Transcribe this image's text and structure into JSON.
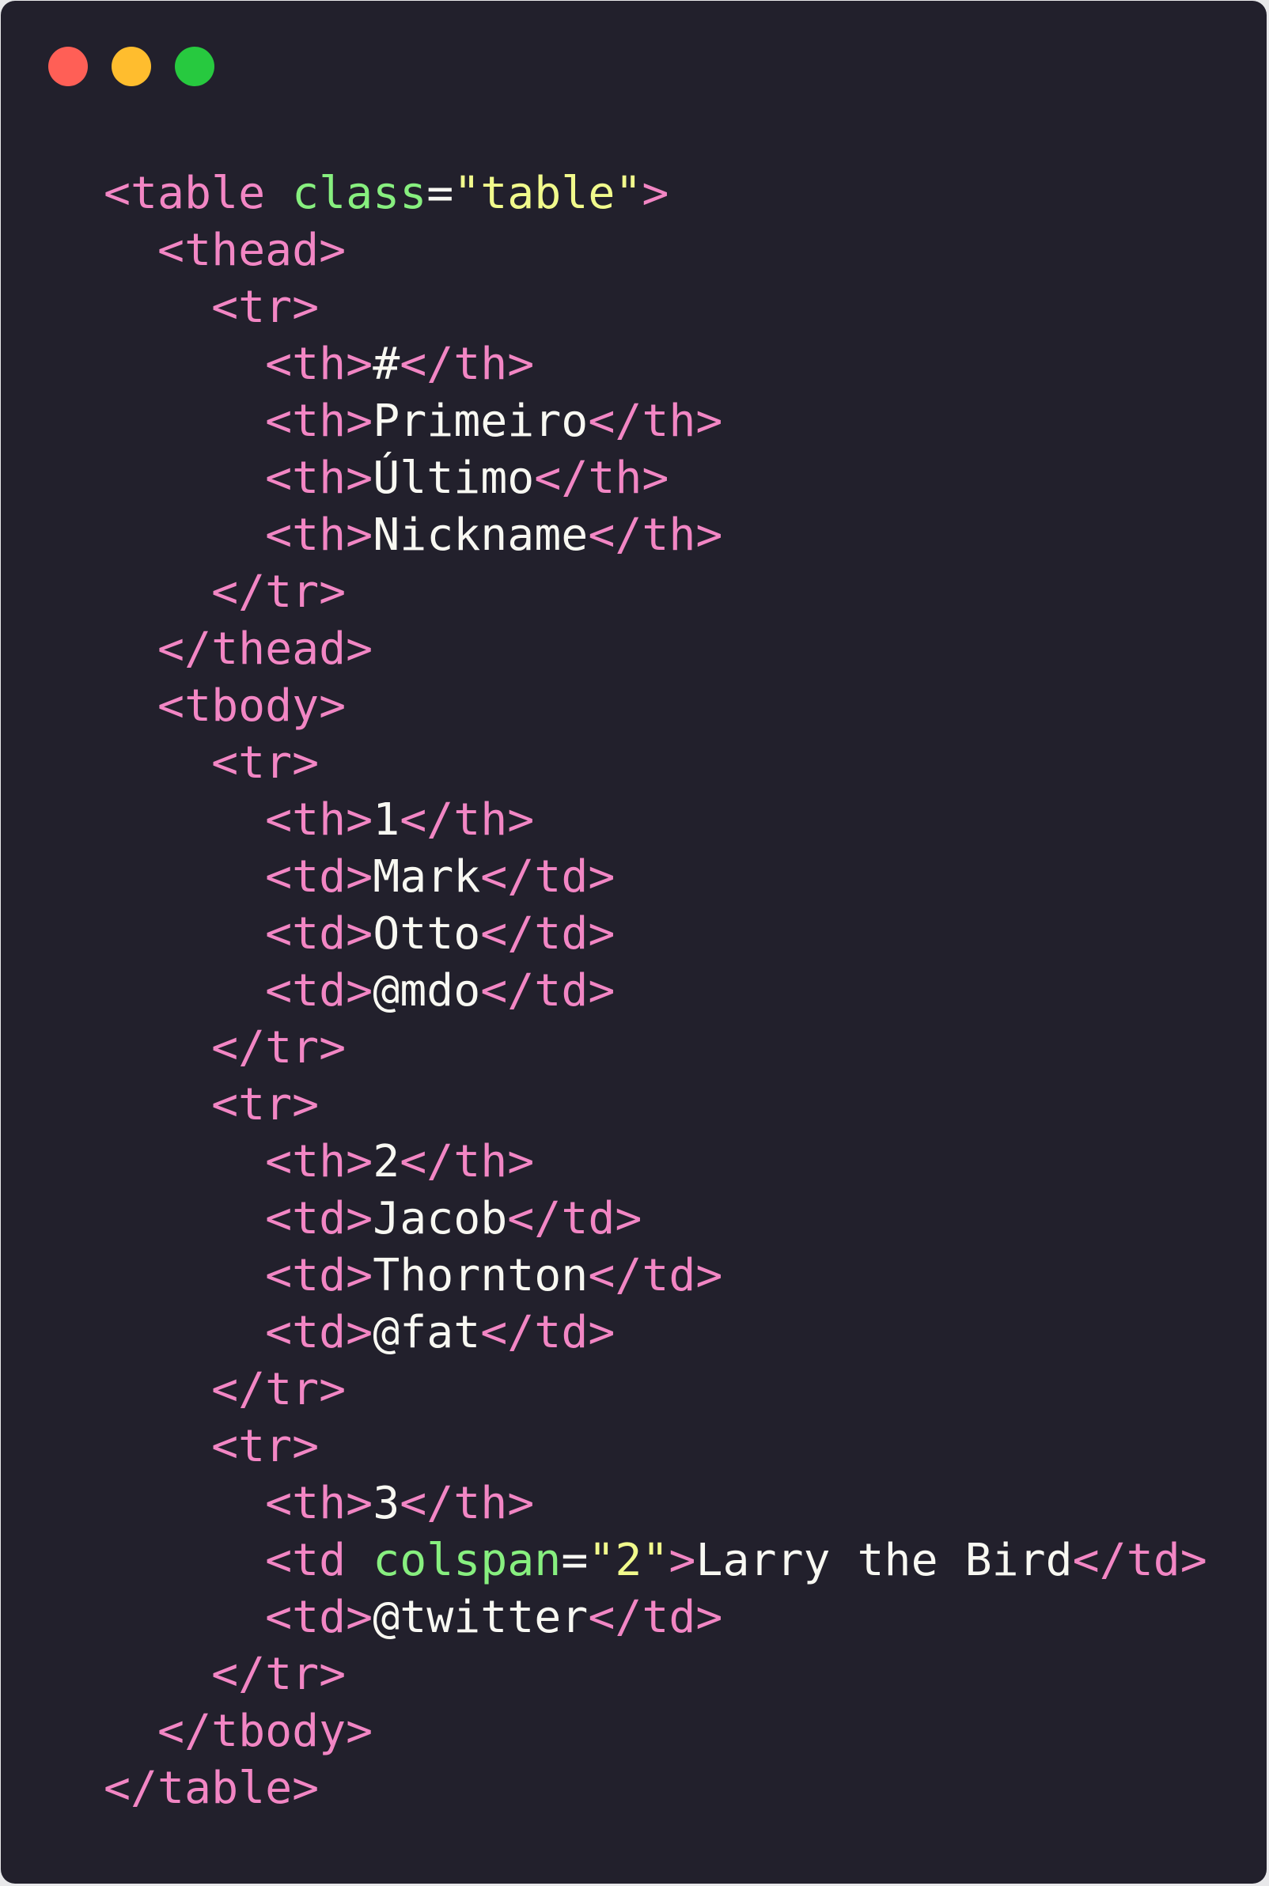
{
  "colors": {
    "background": "#22202c",
    "page_background": "#e8e8ea",
    "window_close": "#ff5f56",
    "window_minimize": "#ffbd2e",
    "window_maximize": "#27c93f",
    "tag": "#f286c4",
    "attribute": "#87ef7f",
    "string": "#f1fa8c",
    "text": "#f8f8f2"
  },
  "window_controls": [
    {
      "name": "close-icon",
      "color": "#ff5f56"
    },
    {
      "name": "minimize-icon",
      "color": "#ffbd2e"
    },
    {
      "name": "maximize-icon",
      "color": "#27c93f"
    }
  ],
  "code": {
    "language": "html",
    "lines": [
      [
        [
          "tag",
          "<table "
        ],
        [
          "attr",
          "class"
        ],
        [
          "text",
          "="
        ],
        [
          "str",
          "\"table\""
        ],
        [
          "tag",
          ">"
        ]
      ],
      [
        [
          "text",
          "  "
        ],
        [
          "tag",
          "<thead>"
        ]
      ],
      [
        [
          "text",
          "    "
        ],
        [
          "tag",
          "<tr>"
        ]
      ],
      [
        [
          "text",
          "      "
        ],
        [
          "tag",
          "<th>"
        ],
        [
          "text",
          "#"
        ],
        [
          "tag",
          "</th>"
        ]
      ],
      [
        [
          "text",
          "      "
        ],
        [
          "tag",
          "<th>"
        ],
        [
          "text",
          "Primeiro"
        ],
        [
          "tag",
          "</th>"
        ]
      ],
      [
        [
          "text",
          "      "
        ],
        [
          "tag",
          "<th>"
        ],
        [
          "text",
          "Último"
        ],
        [
          "tag",
          "</th>"
        ]
      ],
      [
        [
          "text",
          "      "
        ],
        [
          "tag",
          "<th>"
        ],
        [
          "text",
          "Nickname"
        ],
        [
          "tag",
          "</th>"
        ]
      ],
      [
        [
          "text",
          "    "
        ],
        [
          "tag",
          "</tr>"
        ]
      ],
      [
        [
          "text",
          "  "
        ],
        [
          "tag",
          "</thead>"
        ]
      ],
      [
        [
          "text",
          "  "
        ],
        [
          "tag",
          "<tbody>"
        ]
      ],
      [
        [
          "text",
          "    "
        ],
        [
          "tag",
          "<tr>"
        ]
      ],
      [
        [
          "text",
          "      "
        ],
        [
          "tag",
          "<th>"
        ],
        [
          "text",
          "1"
        ],
        [
          "tag",
          "</th>"
        ]
      ],
      [
        [
          "text",
          "      "
        ],
        [
          "tag",
          "<td>"
        ],
        [
          "text",
          "Mark"
        ],
        [
          "tag",
          "</td>"
        ]
      ],
      [
        [
          "text",
          "      "
        ],
        [
          "tag",
          "<td>"
        ],
        [
          "text",
          "Otto"
        ],
        [
          "tag",
          "</td>"
        ]
      ],
      [
        [
          "text",
          "      "
        ],
        [
          "tag",
          "<td>"
        ],
        [
          "text",
          "@mdo"
        ],
        [
          "tag",
          "</td>"
        ]
      ],
      [
        [
          "text",
          "    "
        ],
        [
          "tag",
          "</tr>"
        ]
      ],
      [
        [
          "text",
          "    "
        ],
        [
          "tag",
          "<tr>"
        ]
      ],
      [
        [
          "text",
          "      "
        ],
        [
          "tag",
          "<th>"
        ],
        [
          "text",
          "2"
        ],
        [
          "tag",
          "</th>"
        ]
      ],
      [
        [
          "text",
          "      "
        ],
        [
          "tag",
          "<td>"
        ],
        [
          "text",
          "Jacob"
        ],
        [
          "tag",
          "</td>"
        ]
      ],
      [
        [
          "text",
          "      "
        ],
        [
          "tag",
          "<td>"
        ],
        [
          "text",
          "Thornton"
        ],
        [
          "tag",
          "</td>"
        ]
      ],
      [
        [
          "text",
          "      "
        ],
        [
          "tag",
          "<td>"
        ],
        [
          "text",
          "@fat"
        ],
        [
          "tag",
          "</td>"
        ]
      ],
      [
        [
          "text",
          "    "
        ],
        [
          "tag",
          "</tr>"
        ]
      ],
      [
        [
          "text",
          "    "
        ],
        [
          "tag",
          "<tr>"
        ]
      ],
      [
        [
          "text",
          "      "
        ],
        [
          "tag",
          "<th>"
        ],
        [
          "text",
          "3"
        ],
        [
          "tag",
          "</th>"
        ]
      ],
      [
        [
          "text",
          "      "
        ],
        [
          "tag",
          "<td "
        ],
        [
          "attr",
          "colspan"
        ],
        [
          "text",
          "="
        ],
        [
          "str",
          "\"2\""
        ],
        [
          "tag",
          ">"
        ],
        [
          "text",
          "Larry the Bird"
        ],
        [
          "tag",
          "</td>"
        ]
      ],
      [
        [
          "text",
          "      "
        ],
        [
          "tag",
          "<td>"
        ],
        [
          "text",
          "@twitter"
        ],
        [
          "tag",
          "</td>"
        ]
      ],
      [
        [
          "text",
          "    "
        ],
        [
          "tag",
          "</tr>"
        ]
      ],
      [
        [
          "text",
          "  "
        ],
        [
          "tag",
          "</tbody>"
        ]
      ],
      [
        [
          "tag",
          "</table>"
        ]
      ]
    ]
  }
}
